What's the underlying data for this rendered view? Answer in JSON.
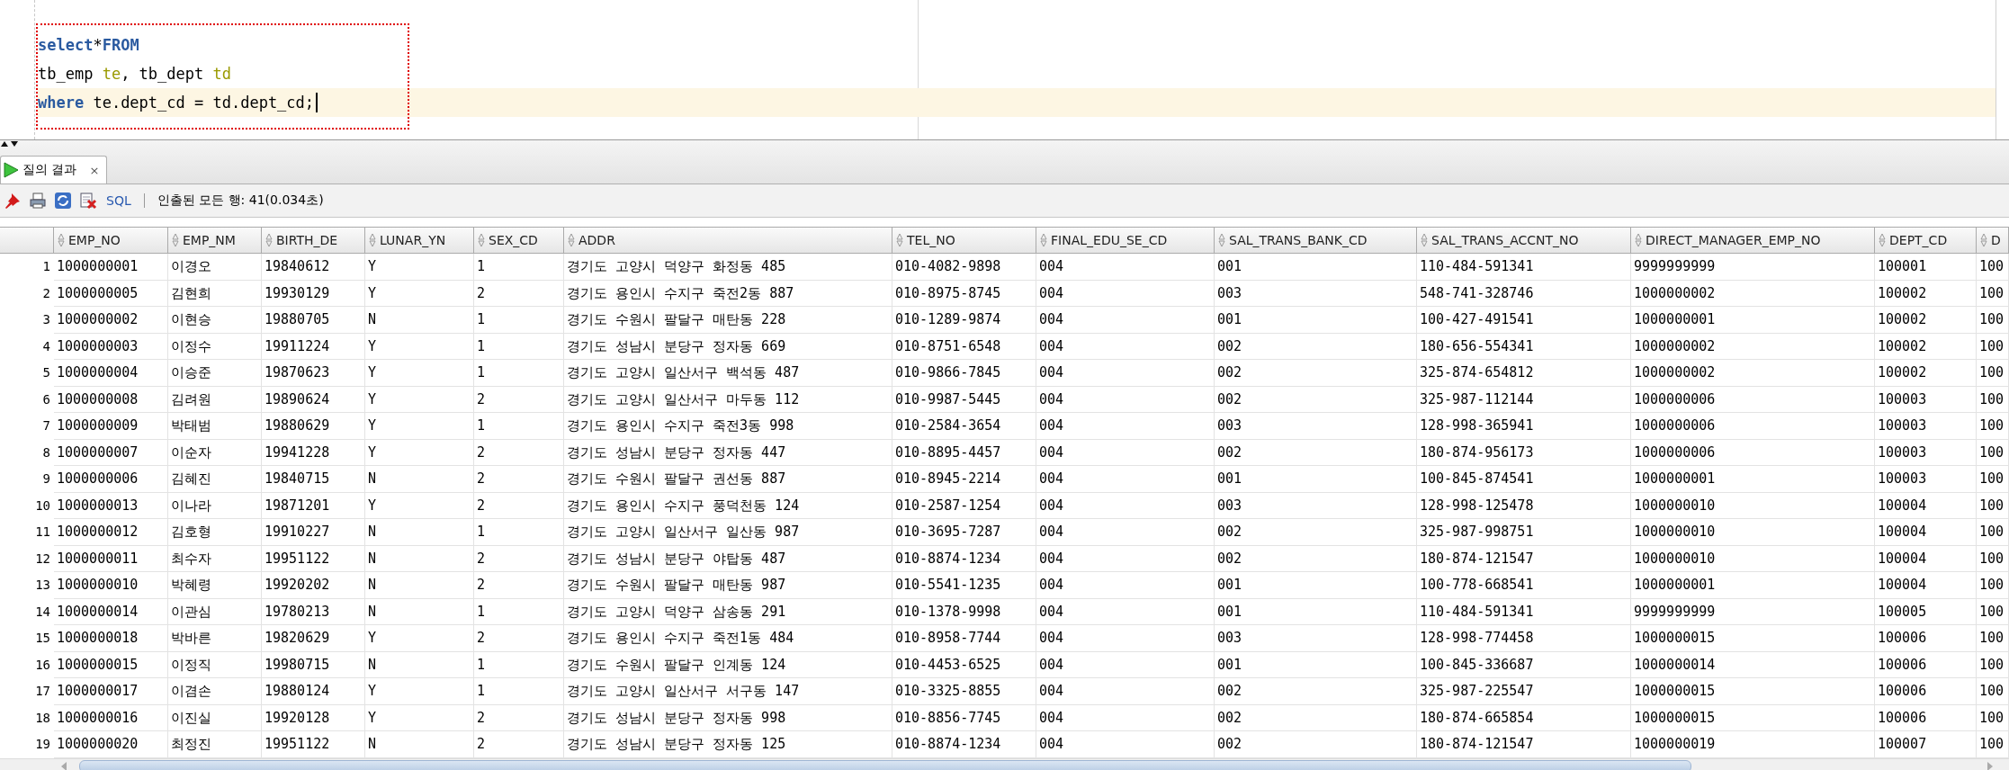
{
  "editor": {
    "lines": [
      {
        "current": false,
        "tokens": [
          {
            "kind": "keyword",
            "text": "select"
          },
          {
            "kind": "plain",
            "text": "*"
          },
          {
            "kind": "keyword",
            "text": "FROM"
          }
        ]
      },
      {
        "current": false,
        "tokens": [
          {
            "kind": "plain",
            "text": "tb_emp "
          },
          {
            "kind": "alias",
            "text": "te"
          },
          {
            "kind": "plain",
            "text": ", tb_dept "
          },
          {
            "kind": "alias",
            "text": "td"
          }
        ]
      },
      {
        "current": true,
        "tokens": [
          {
            "kind": "keyword",
            "text": "where"
          },
          {
            "kind": "plain",
            "text": " te.dept_cd = td.dept_cd;"
          }
        ]
      }
    ]
  },
  "result_tab": {
    "label": "질의 결과",
    "close": "×",
    "selected": true
  },
  "toolbar": {
    "sql_link": "SQL",
    "status": "인출된 모든 행: 41(0.034초)"
  },
  "table": {
    "columns": [
      "EMP_NO",
      "EMP_NM",
      "BIRTH_DE",
      "LUNAR_YN",
      "SEX_CD",
      "ADDR",
      "TEL_NO",
      "FINAL_EDU_SE_CD",
      "SAL_TRANS_BANK_CD",
      "SAL_TRANS_ACCNT_NO",
      "DIRECT_MANAGER_EMP_NO",
      "DEPT_CD",
      "D"
    ],
    "rows": [
      {
        "num": "1",
        "cells": [
          "1000000001",
          "이경오",
          "19840612",
          "Y",
          "1",
          "경기도 고양시 덕양구 화정동 485",
          "010-4082-9898",
          "004",
          "001",
          "110-484-591341",
          "9999999999",
          "100001",
          "100"
        ]
      },
      {
        "num": "2",
        "cells": [
          "1000000005",
          "김현희",
          "19930129",
          "Y",
          "2",
          "경기도 용인시 수지구 죽전2동 887",
          "010-8975-8745",
          "004",
          "003",
          "548-741-328746",
          "1000000002",
          "100002",
          "100"
        ]
      },
      {
        "num": "3",
        "cells": [
          "1000000002",
          "이현승",
          "19880705",
          "N",
          "1",
          "경기도 수원시 팔달구 매탄동 228",
          "010-1289-9874",
          "004",
          "001",
          "100-427-491541",
          "1000000001",
          "100002",
          "100"
        ]
      },
      {
        "num": "4",
        "cells": [
          "1000000003",
          "이정수",
          "19911224",
          "Y",
          "1",
          "경기도 성남시 분당구 정자동 669",
          "010-8751-6548",
          "004",
          "002",
          "180-656-554341",
          "1000000002",
          "100002",
          "100"
        ]
      },
      {
        "num": "5",
        "cells": [
          "1000000004",
          "이승준",
          "19870623",
          "Y",
          "1",
          "경기도 고양시 일산서구 백석동 487",
          "010-9866-7845",
          "004",
          "002",
          "325-874-654812",
          "1000000002",
          "100002",
          "100"
        ]
      },
      {
        "num": "6",
        "cells": [
          "1000000008",
          "김려원",
          "19890624",
          "Y",
          "2",
          "경기도 고양시 일산서구 마두동 112",
          "010-9987-5445",
          "004",
          "002",
          "325-987-112144",
          "1000000006",
          "100003",
          "100"
        ]
      },
      {
        "num": "7",
        "cells": [
          "1000000009",
          "박태범",
          "19880629",
          "Y",
          "1",
          "경기도 용인시 수지구 죽전3동 998",
          "010-2584-3654",
          "004",
          "003",
          "128-998-365941",
          "1000000006",
          "100003",
          "100"
        ]
      },
      {
        "num": "8",
        "cells": [
          "1000000007",
          "이순자",
          "19941228",
          "Y",
          "2",
          "경기도 성남시 분당구 정자동 447",
          "010-8895-4457",
          "004",
          "002",
          "180-874-956173",
          "1000000006",
          "100003",
          "100"
        ]
      },
      {
        "num": "9",
        "cells": [
          "1000000006",
          "김혜진",
          "19840715",
          "N",
          "2",
          "경기도 수원시 팔달구 권선동 887",
          "010-8945-2214",
          "004",
          "001",
          "100-845-874541",
          "1000000001",
          "100003",
          "100"
        ]
      },
      {
        "num": "10",
        "cells": [
          "1000000013",
          "이나라",
          "19871201",
          "Y",
          "2",
          "경기도 용인시 수지구 풍덕천동 124",
          "010-2587-1254",
          "004",
          "003",
          "128-998-125478",
          "1000000010",
          "100004",
          "100"
        ]
      },
      {
        "num": "11",
        "cells": [
          "1000000012",
          "김호형",
          "19910227",
          "N",
          "1",
          "경기도 고양시 일산서구 일산동 987",
          "010-3695-7287",
          "004",
          "002",
          "325-987-998751",
          "1000000010",
          "100004",
          "100"
        ]
      },
      {
        "num": "12",
        "cells": [
          "1000000011",
          "최수자",
          "19951122",
          "N",
          "2",
          "경기도 성남시 분당구 야탑동 487",
          "010-8874-1234",
          "004",
          "002",
          "180-874-121547",
          "1000000010",
          "100004",
          "100"
        ]
      },
      {
        "num": "13",
        "cells": [
          "1000000010",
          "박혜령",
          "19920202",
          "N",
          "2",
          "경기도 수원시 팔달구 매탄동 987",
          "010-5541-1235",
          "004",
          "001",
          "100-778-668541",
          "1000000001",
          "100004",
          "100"
        ]
      },
      {
        "num": "14",
        "cells": [
          "1000000014",
          "이관심",
          "19780213",
          "N",
          "1",
          "경기도 고양시 덕양구 삼송동 291",
          "010-1378-9998",
          "004",
          "001",
          "110-484-591341",
          "9999999999",
          "100005",
          "100"
        ]
      },
      {
        "num": "15",
        "cells": [
          "1000000018",
          "박바른",
          "19820629",
          "Y",
          "2",
          "경기도 용인시 수지구 죽전1동 484",
          "010-8958-7744",
          "004",
          "003",
          "128-998-774458",
          "1000000015",
          "100006",
          "100"
        ]
      },
      {
        "num": "16",
        "cells": [
          "1000000015",
          "이정직",
          "19980715",
          "N",
          "1",
          "경기도 수원시 팔달구 인계동 124",
          "010-4453-6525",
          "004",
          "001",
          "100-845-336687",
          "1000000014",
          "100006",
          "100"
        ]
      },
      {
        "num": "17",
        "cells": [
          "1000000017",
          "이겸손",
          "19880124",
          "Y",
          "1",
          "경기도 고양시 일산서구 서구동 147",
          "010-3325-8855",
          "004",
          "002",
          "325-987-225547",
          "1000000015",
          "100006",
          "100"
        ]
      },
      {
        "num": "18",
        "cells": [
          "1000000016",
          "이진실",
          "19920128",
          "Y",
          "2",
          "경기도 성남시 분당구 정자동 998",
          "010-8856-7745",
          "004",
          "002",
          "180-874-665854",
          "1000000015",
          "100006",
          "100"
        ]
      },
      {
        "num": "19",
        "cells": [
          "1000000020",
          "최정진",
          "19951122",
          "N",
          "2",
          "경기도 성남시 분당구 정자동 125",
          "010-8874-1234",
          "004",
          "002",
          "180-874-121547",
          "1000000019",
          "100007",
          "100"
        ]
      }
    ]
  }
}
